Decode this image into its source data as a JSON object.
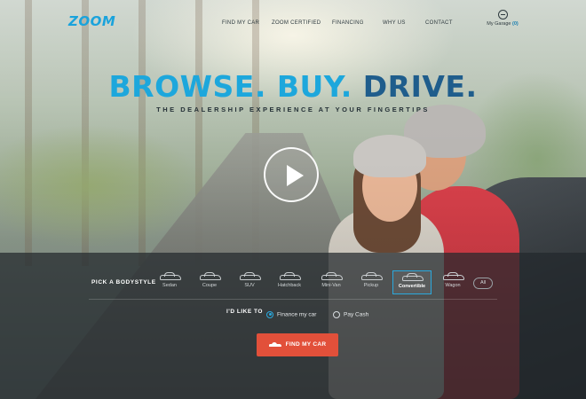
{
  "header": {
    "logo": "ZOOM",
    "nav": [
      {
        "label": "FIND MY CAR"
      },
      {
        "label": "ZOOM CERTIFIED"
      },
      {
        "label": "FINANCING"
      },
      {
        "label": "WHY US"
      },
      {
        "label": "CONTACT"
      }
    ],
    "garage": {
      "label": "My Garage",
      "count": "(0)",
      "icon": "steering-wheel-icon"
    }
  },
  "hero": {
    "headline_part1": "BROWSE. BUY.",
    "headline_part2": "DRIVE.",
    "tagline": "THE DEALERSHIP EXPERIENCE AT YOUR FINGERTIPS",
    "play_icon": "play-icon"
  },
  "search": {
    "bodystyle_label": "PICK A BODYSTYLE",
    "bodystyles": [
      {
        "label": "Sedan",
        "selected": false
      },
      {
        "label": "Coupe",
        "selected": false
      },
      {
        "label": "SUV",
        "selected": false
      },
      {
        "label": "Hatchback",
        "selected": false
      },
      {
        "label": "Mini-Van",
        "selected": false
      },
      {
        "label": "Pickup",
        "selected": false
      },
      {
        "label": "Convertible",
        "selected": true
      },
      {
        "label": "Wagon",
        "selected": false
      }
    ],
    "all_label": "All",
    "like_label": "I'D LIKE TO",
    "options": [
      {
        "label": "Finance my car",
        "checked": true
      },
      {
        "label": "Pay Cash",
        "checked": false
      }
    ],
    "find_button": "FIND MY CAR"
  },
  "colors": {
    "accent_blue": "#1da7dc",
    "dark_blue": "#1f5d8c",
    "cta_red": "#e2503a"
  }
}
